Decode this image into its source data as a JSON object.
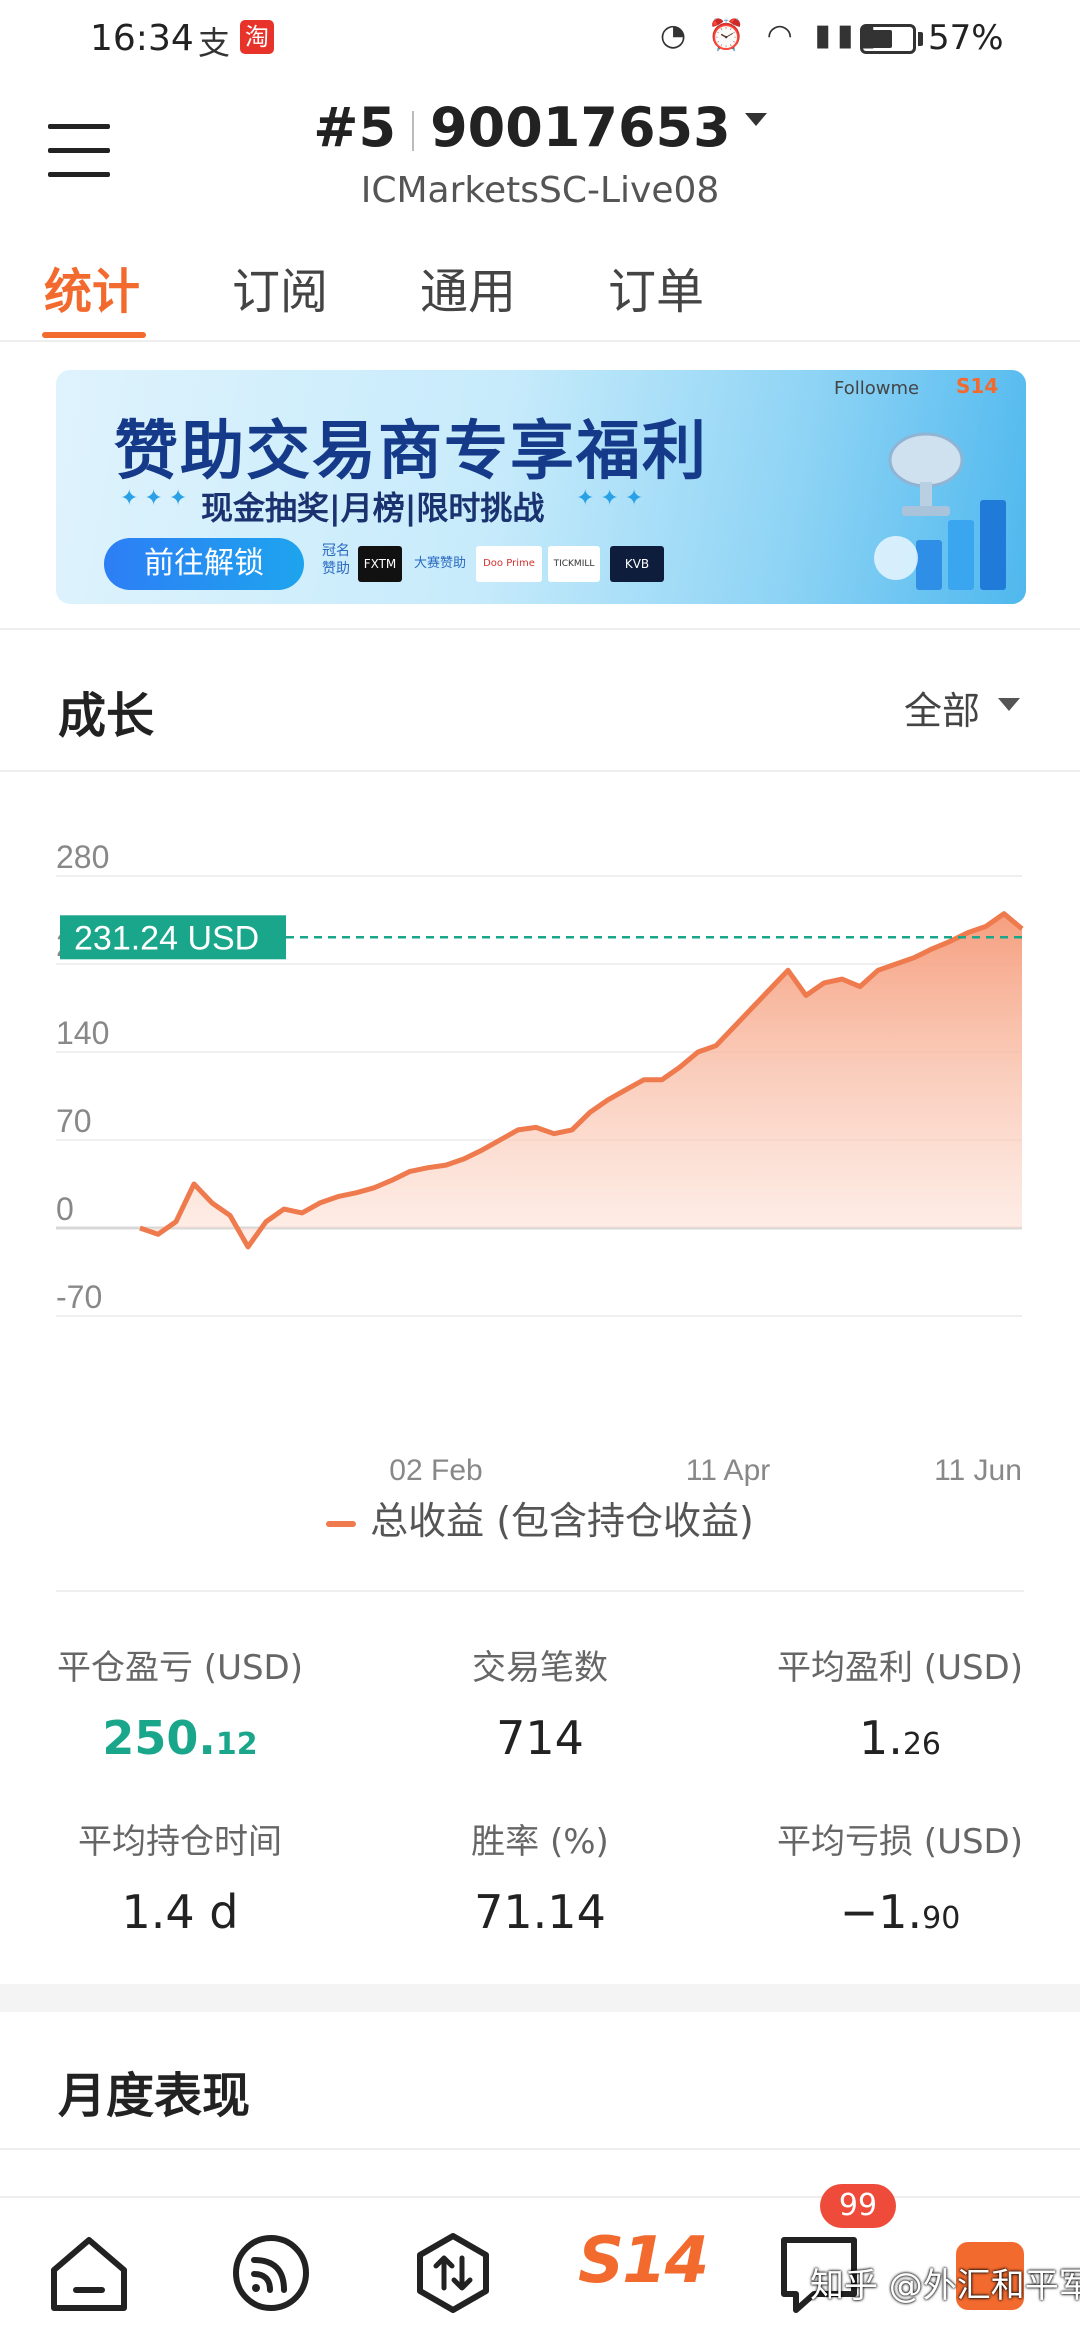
{
  "status_bar": {
    "time": "16:34",
    "app_icons": [
      "支",
      "淘"
    ],
    "battery": "57%"
  },
  "header": {
    "rank": "#5",
    "account": "90017653",
    "server": "ICMarketsSC-Live08"
  },
  "tabs": [
    {
      "label": "统计",
      "active": true
    },
    {
      "label": "订阅",
      "active": false
    },
    {
      "label": "通用",
      "active": false
    },
    {
      "label": "订单",
      "active": false
    }
  ],
  "banner": {
    "title": "赞助交易商专享福利",
    "subtitle": "现金抽奖|月榜|限时挑战",
    "button": "前往解锁",
    "sponsor_label": "冠名赞助",
    "event_sponsor_label": "大赛赞助",
    "sponsors": [
      "FXTM",
      "Doo Prime",
      "TICKMILL",
      "KVB"
    ],
    "brand": "Followme",
    "brand2": "S14"
  },
  "growth": {
    "title": "成长",
    "filter": "全部"
  },
  "chart_data": {
    "type": "area",
    "y_ticks": [
      "280",
      "210",
      "140",
      "70",
      "0",
      "-70"
    ],
    "x_ticks": [
      "02 Feb",
      "11 Apr",
      "11 Jun"
    ],
    "ylim": [
      -70,
      280
    ],
    "current_value_label": "231.24 USD",
    "current_value": 231.24,
    "series": [
      {
        "name": "总收益 (包含持仓收益)",
        "color": "#ee7a4d",
        "values": [
          0,
          -5,
          5,
          35,
          20,
          10,
          -15,
          5,
          15,
          12,
          20,
          25,
          28,
          32,
          38,
          45,
          48,
          50,
          55,
          62,
          70,
          78,
          80,
          75,
          78,
          92,
          102,
          110,
          118,
          118,
          128,
          140,
          145,
          160,
          175,
          190,
          205,
          185,
          195,
          198,
          192,
          205,
          210,
          215,
          222,
          228,
          235,
          240,
          250,
          238
        ]
      }
    ]
  },
  "stats": [
    {
      "label": "平仓盈亏 (USD)",
      "int": "250.",
      "dec": "12",
      "highlight": true
    },
    {
      "label": "交易笔数",
      "int": "714",
      "dec": "",
      "highlight": false
    },
    {
      "label": "平均盈利 (USD)",
      "int": "1.",
      "dec": "26",
      "highlight": false
    },
    {
      "label": "平均持仓时间",
      "int": "1.4 d",
      "dec": "",
      "highlight": false
    },
    {
      "label": "胜率 (%)",
      "int": "71.14",
      "dec": "",
      "highlight": false
    },
    {
      "label": "平均亏损 (USD)",
      "int": "−1.",
      "dec": "90",
      "highlight": false
    }
  ],
  "monthly": {
    "title": "月度表现"
  },
  "bottom_nav": {
    "home_icon": "home-icon",
    "feed_icon": "feed-icon",
    "trade_icon": "trade-icon",
    "s14_label": "S14",
    "messages_badge": "99",
    "watermark": "知乎 @外汇和平军"
  }
}
